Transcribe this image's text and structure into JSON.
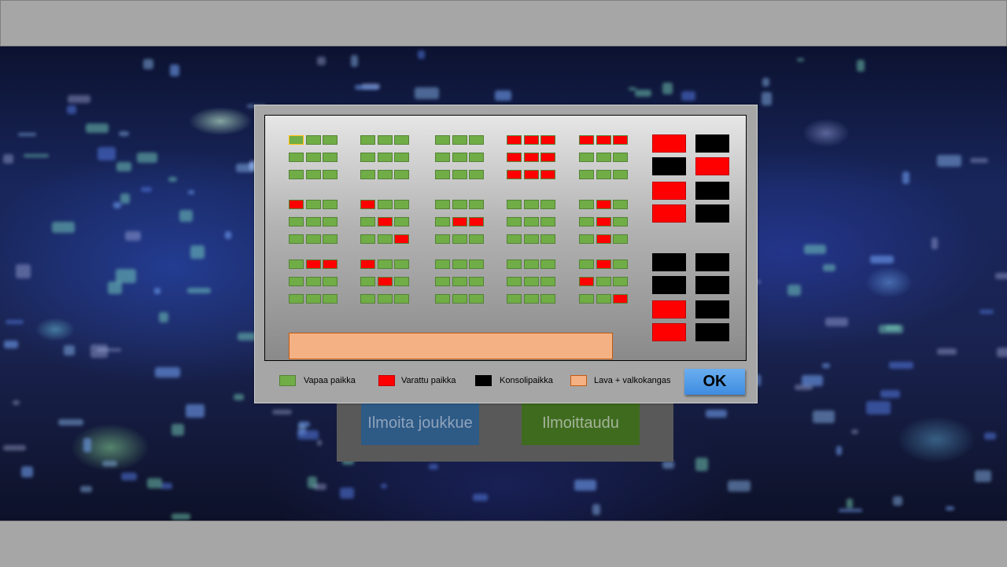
{
  "colors": {
    "free": "#70ad47",
    "taken": "#ff0000",
    "console": "#000000",
    "stage": "#f4b183",
    "selected_outline": "#ffc000",
    "ok_button": "#5b9bd5",
    "team_button": "#2e5a86",
    "join_button": "#3f6b1e"
  },
  "background_buttons": {
    "team_label": "Ilmoita joukkue",
    "join_label": "Ilmoittaudu"
  },
  "seat_map": {
    "legend": {
      "free_label": "Vapaa paikka",
      "taken_label": "Varattu paikka",
      "console_label": "Konsolipaikka",
      "stage_label": "Lava + valkokangas"
    },
    "ok_label": "OK",
    "selected_seat": "block-1-1 row 1 seat 1",
    "blocks": [
      [
        "FFF",
        "FFF",
        "FFF"
      ],
      [
        "FFF",
        "FFF",
        "FFF"
      ],
      [
        "FFF",
        "FFF",
        "FFF"
      ],
      [
        "RRR",
        "RRR",
        "RRR"
      ],
      [
        "RRR",
        "FFF",
        "FFF"
      ],
      [
        "RFF",
        "FFF",
        "FFF"
      ],
      [
        "RFF",
        "FRF",
        "FFR"
      ],
      [
        "FFF",
        "FRR",
        "FFF"
      ],
      [
        "FFF",
        "FFF",
        "FFF"
      ],
      [
        "FRF",
        "FRF",
        "FRF"
      ],
      [
        "FRR",
        "FFF",
        "FFF"
      ],
      [
        "RFF",
        "FRF",
        "FFF"
      ],
      [
        "FFF",
        "FFF",
        "FFF"
      ],
      [
        "FFF",
        "FFF",
        "FFF"
      ],
      [
        "FRF",
        "RFF",
        "FFR"
      ]
    ],
    "console_boxes": [
      [
        "red",
        "black"
      ],
      [
        "black",
        "red"
      ],
      [
        "red",
        "black"
      ],
      [
        "red",
        "black"
      ],
      [
        "black",
        "black"
      ],
      [
        "black",
        "black"
      ],
      [
        "red",
        "black"
      ],
      [
        "red",
        "black"
      ]
    ]
  }
}
